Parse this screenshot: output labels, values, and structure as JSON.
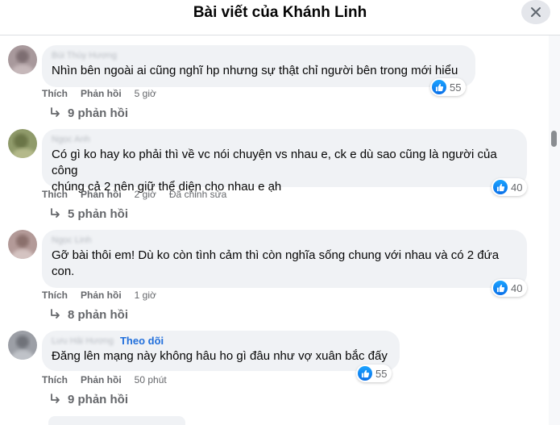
{
  "header": {
    "title": "Bài viết của Khánh Linh",
    "close_icon": "close-icon"
  },
  "comments": [
    {
      "author": "Bùi Thùy Hương",
      "text": "Nhìn bên ngoài ai cũng nghĩ hp nhưng sự thật chỉ người bên trong mới hiểu",
      "reactions": "55",
      "like": "Thích",
      "reply": "Phản hồi",
      "time": "5 giờ",
      "replies": "9 phản hồi"
    },
    {
      "author": "Ngọc Anh",
      "text_lines": [
        "Có gì ko hay ko phải thì về vc nói chuyện vs nhau e, ck e dù sao cũng là người của công",
        "chúng cả 2 nên giữ thể diện cho nhau e ạh"
      ],
      "reactions": "40",
      "like": "Thích",
      "reply": "Phản hồi",
      "time": "2 giờ",
      "edited": "Đã chỉnh sửa",
      "replies": "5 phản hồi"
    },
    {
      "author": "Ngọc Linh",
      "text_lines": [
        "Gỡ bài thôi em! Dù ko còn tình cảm thì còn nghĩa sống chung với nhau và có 2 đứa",
        "con."
      ],
      "reactions": "40",
      "like": "Thích",
      "reply": "Phản hồi",
      "time": "1 giờ",
      "replies": "8 phản hồi"
    },
    {
      "author": "Lưu Hải Hương",
      "follow": "Theo dõi",
      "text": "Đăng lên mạng này không hâu ho gì đâu như vợ xuân bắc đấy",
      "reactions": "55",
      "like": "Thích",
      "reply": "Phản hồi",
      "time": "50 phút",
      "replies": "9 phản hồi"
    }
  ],
  "colors": {
    "accent": "#216fdb",
    "bubble": "#f0f2f5",
    "muted": "#65676b",
    "like_blue": "#0a6fe8"
  }
}
